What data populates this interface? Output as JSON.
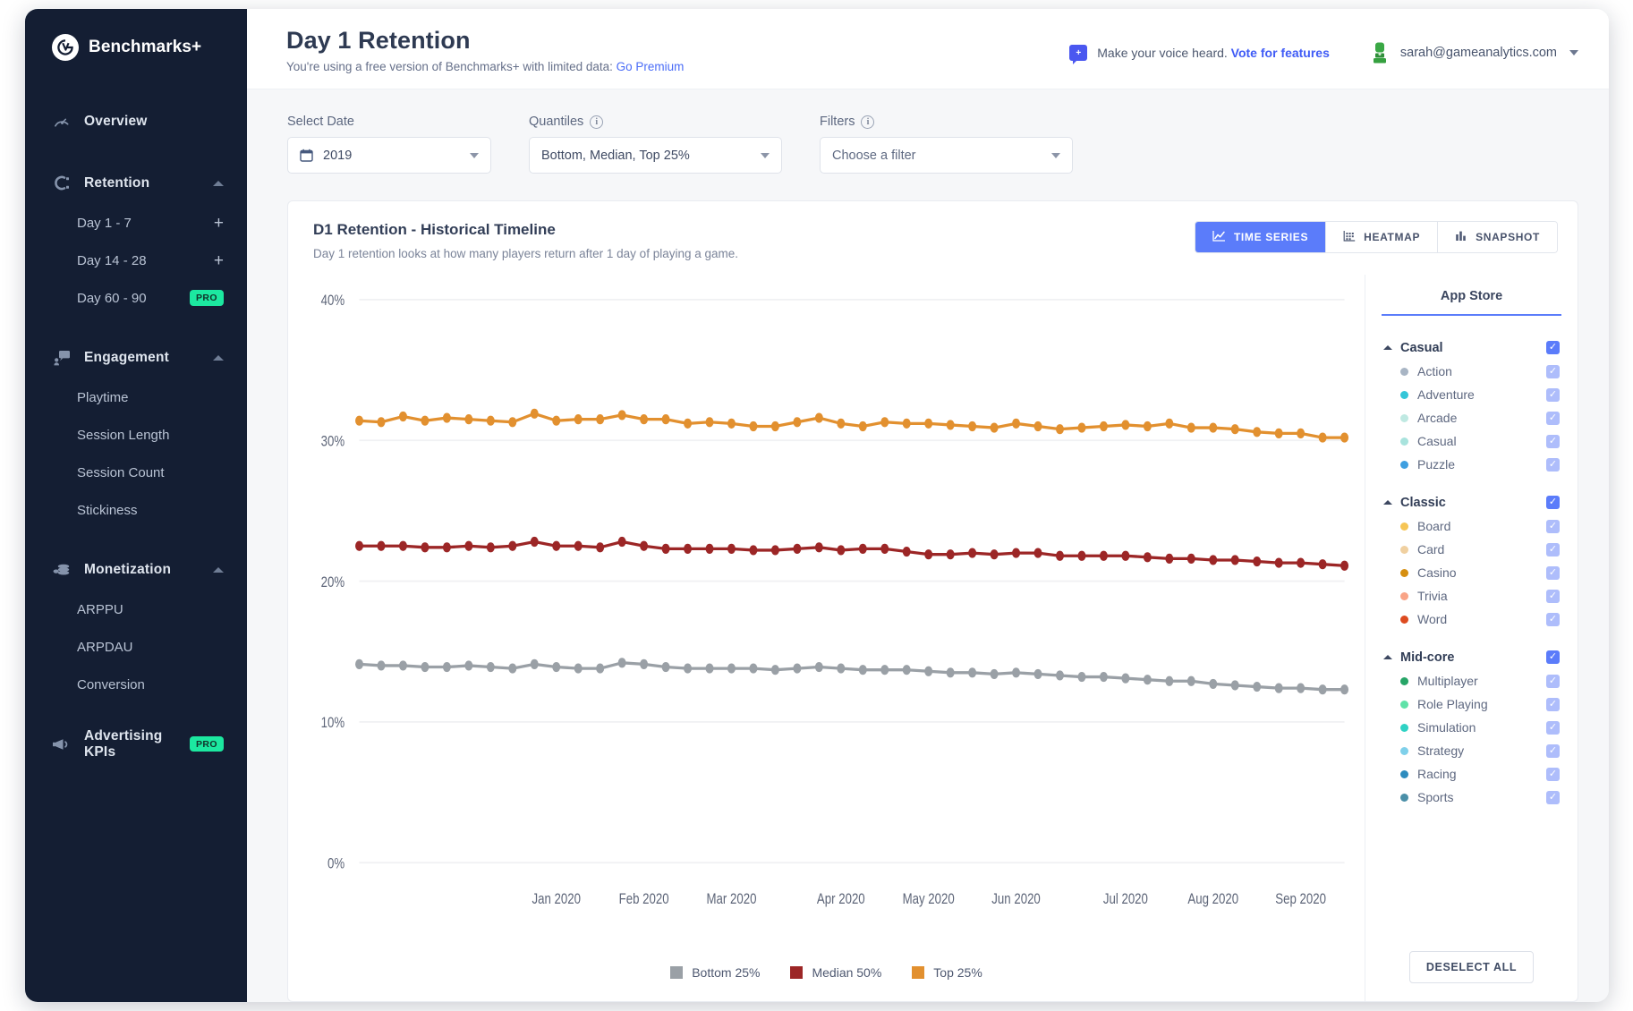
{
  "sidebar": {
    "brand": "Benchmarks+",
    "logo_icon": "ga-logo-icon",
    "groups": [
      {
        "label": "Overview",
        "icon": "gauge-icon",
        "collapsible": false,
        "items": []
      },
      {
        "label": "Retention",
        "icon": "retention-icon",
        "collapsible": true,
        "items": [
          {
            "label": "Day 1 - 7",
            "badge": "+"
          },
          {
            "label": "Day 14 - 28",
            "badge": "+"
          },
          {
            "label": "Day 60 - 90",
            "badge": "PRO"
          }
        ]
      },
      {
        "label": "Engagement",
        "icon": "engagement-icon",
        "collapsible": true,
        "items": [
          {
            "label": "Playtime",
            "badge": ""
          },
          {
            "label": "Session Length",
            "badge": ""
          },
          {
            "label": "Session Count",
            "badge": ""
          },
          {
            "label": "Stickiness",
            "badge": ""
          }
        ]
      },
      {
        "label": "Monetization",
        "icon": "coins-icon",
        "collapsible": true,
        "items": [
          {
            "label": "ARPPU",
            "badge": ""
          },
          {
            "label": "ARPDAU",
            "badge": ""
          },
          {
            "label": "Conversion",
            "badge": ""
          }
        ]
      },
      {
        "label": "Advertising KPIs",
        "icon": "megaphone-icon",
        "collapsible": false,
        "badge": "PRO",
        "items": []
      }
    ]
  },
  "header": {
    "title": "Day 1 Retention",
    "subtitle_prefix": "You're using a free version of Benchmarks+ with limited data: ",
    "subtitle_link": "Go Premium",
    "voice_text": "Make your voice heard. ",
    "voice_link": "Vote for features",
    "account_email": "sarah@gameanalytics.com"
  },
  "filters": {
    "date": {
      "label": "Select Date",
      "value": "2019",
      "icon": "calendar-icon"
    },
    "quantiles": {
      "label": "Quantiles",
      "value": "Bottom, Median, Top 25%",
      "info": true
    },
    "filters": {
      "label": "Filters",
      "placeholder": "Choose a filter",
      "info": true
    }
  },
  "card": {
    "title": "D1 Retention - Historical Timeline",
    "description": "Day 1 retention looks at how many players return after 1 day of playing a game.",
    "views": [
      {
        "label": "TIME SERIES",
        "icon": "line-chart-icon",
        "active": true
      },
      {
        "label": "HEATMAP",
        "icon": "heatmap-icon",
        "active": false
      },
      {
        "label": "SNAPSHOT",
        "icon": "bar-chart-icon",
        "active": false
      }
    ]
  },
  "chart_data": {
    "type": "line",
    "title": "D1 Retention - Historical Timeline",
    "xlabel": "",
    "ylabel": "",
    "ylim": [
      0,
      40
    ],
    "yticks": [
      0,
      10,
      20,
      30,
      40
    ],
    "ytick_labels": [
      "0%",
      "10%",
      "20%",
      "30%",
      "40%"
    ],
    "grid": true,
    "legend_position": "bottom",
    "xtick_labels": [
      "Jan 2020",
      "Feb 2020",
      "Mar 2020",
      "Apr 2020",
      "May 2020",
      "Jun 2020",
      "Jul 2020",
      "Aug 2020",
      "Sep 2020"
    ],
    "xtick_indices": [
      9,
      13,
      17,
      22,
      26,
      30,
      35,
      39,
      43
    ],
    "n_points": 46,
    "series": [
      {
        "name": "Top 25%",
        "color": "#e2902f",
        "values": [
          31.4,
          31.3,
          31.7,
          31.4,
          31.6,
          31.5,
          31.4,
          31.3,
          31.9,
          31.4,
          31.5,
          31.5,
          31.8,
          31.5,
          31.5,
          31.2,
          31.3,
          31.2,
          31.0,
          31.0,
          31.3,
          31.6,
          31.2,
          31.0,
          31.3,
          31.2,
          31.2,
          31.1,
          31.0,
          30.9,
          31.2,
          31.0,
          30.8,
          30.9,
          31.0,
          31.1,
          31.0,
          31.2,
          30.9,
          30.9,
          30.8,
          30.6,
          30.5,
          30.5,
          30.2,
          30.2
        ]
      },
      {
        "name": "Median 50%",
        "color": "#9c2626",
        "values": [
          22.5,
          22.5,
          22.5,
          22.4,
          22.4,
          22.5,
          22.4,
          22.5,
          22.8,
          22.5,
          22.5,
          22.4,
          22.8,
          22.5,
          22.3,
          22.3,
          22.3,
          22.3,
          22.2,
          22.2,
          22.3,
          22.4,
          22.2,
          22.3,
          22.3,
          22.1,
          21.9,
          21.9,
          22.0,
          21.9,
          22.0,
          22.0,
          21.8,
          21.8,
          21.8,
          21.8,
          21.7,
          21.6,
          21.6,
          21.5,
          21.5,
          21.4,
          21.3,
          21.3,
          21.2,
          21.1
        ]
      },
      {
        "name": "Bottom 25%",
        "color": "#9aa0a6",
        "values": [
          14.1,
          14.0,
          14.0,
          13.9,
          13.9,
          14.0,
          13.9,
          13.8,
          14.1,
          13.9,
          13.8,
          13.8,
          14.2,
          14.1,
          13.9,
          13.8,
          13.8,
          13.8,
          13.8,
          13.7,
          13.8,
          13.9,
          13.8,
          13.7,
          13.7,
          13.7,
          13.6,
          13.5,
          13.5,
          13.4,
          13.5,
          13.4,
          13.3,
          13.2,
          13.2,
          13.1,
          13.0,
          12.9,
          12.9,
          12.7,
          12.6,
          12.5,
          12.4,
          12.4,
          12.3,
          12.3
        ]
      }
    ],
    "legend": [
      {
        "label": "Bottom 25%",
        "color": "#9aa0a6"
      },
      {
        "label": "Median 50%",
        "color": "#9c2626"
      },
      {
        "label": "Top 25%",
        "color": "#e2902f"
      }
    ]
  },
  "categories_panel": {
    "tab": "App Store",
    "deselect_label": "DESELECT ALL",
    "groups": [
      {
        "name": "Casual",
        "checked": true,
        "items": [
          {
            "label": "Action",
            "color": "#a8b5c4",
            "checked": true
          },
          {
            "label": "Adventure",
            "color": "#34c6d8",
            "checked": true
          },
          {
            "label": "Arcade",
            "color": "#bfe9e2",
            "checked": true
          },
          {
            "label": "Casual",
            "color": "#a8e3dd",
            "checked": true
          },
          {
            "label": "Puzzle",
            "color": "#3f9fe0",
            "checked": true
          }
        ]
      },
      {
        "name": "Classic",
        "checked": true,
        "items": [
          {
            "label": "Board",
            "color": "#f6c555",
            "checked": true
          },
          {
            "label": "Card",
            "color": "#f0d0a0",
            "checked": true
          },
          {
            "label": "Casino",
            "color": "#d68f10",
            "checked": true
          },
          {
            "label": "Trivia",
            "color": "#f9a487",
            "checked": true
          },
          {
            "label": "Word",
            "color": "#dd4b20",
            "checked": true
          }
        ]
      },
      {
        "name": "Mid-core",
        "checked": true,
        "items": [
          {
            "label": "Multiplayer",
            "color": "#27a567",
            "checked": true
          },
          {
            "label": "Role Playing",
            "color": "#5fe2a8",
            "checked": true
          },
          {
            "label": "Simulation",
            "color": "#2fd2c4",
            "checked": true
          },
          {
            "label": "Strategy",
            "color": "#7fd0ea",
            "checked": true
          },
          {
            "label": "Racing",
            "color": "#2d8cbe",
            "checked": true
          },
          {
            "label": "Sports",
            "color": "#4a8fa8",
            "checked": true
          }
        ]
      }
    ]
  }
}
